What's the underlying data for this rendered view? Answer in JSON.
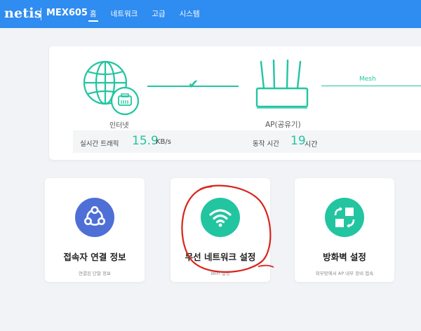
{
  "header": {
    "brand": "netis",
    "model": "MEX605",
    "nav": [
      {
        "label": "홈",
        "active": true
      },
      {
        "label": "네트워크",
        "active": false
      },
      {
        "label": "고급",
        "active": false
      },
      {
        "label": "시스템",
        "active": false
      }
    ]
  },
  "status": {
    "internet_label": "인터넷",
    "ap_label": "AP(공유기)",
    "mesh_label": "Mesh",
    "traffic_label": "실시간 트래픽",
    "traffic_value": "15.9",
    "traffic_unit": "KB/s",
    "uptime_label": "동작 시간",
    "uptime_value": "19",
    "uptime_unit": "시간"
  },
  "cards": [
    {
      "title": "접속자 연결 정보",
      "subtitle": "연결된 단말 정보",
      "color": "#4e6fd6",
      "icon": "share-icon"
    },
    {
      "title": "무선 네트워크 설정",
      "subtitle": "WiFi 설정",
      "color": "#22c5a0",
      "icon": "wifi-icon"
    },
    {
      "title": "방화벽 설정",
      "subtitle": "외부망에서 AP 내부 장비 접속",
      "color": "#22c5a0",
      "icon": "firewall-icon"
    }
  ],
  "colors": {
    "primary": "#2f8cf0",
    "accent": "#22c5a0",
    "annotation": "#d9241c"
  }
}
